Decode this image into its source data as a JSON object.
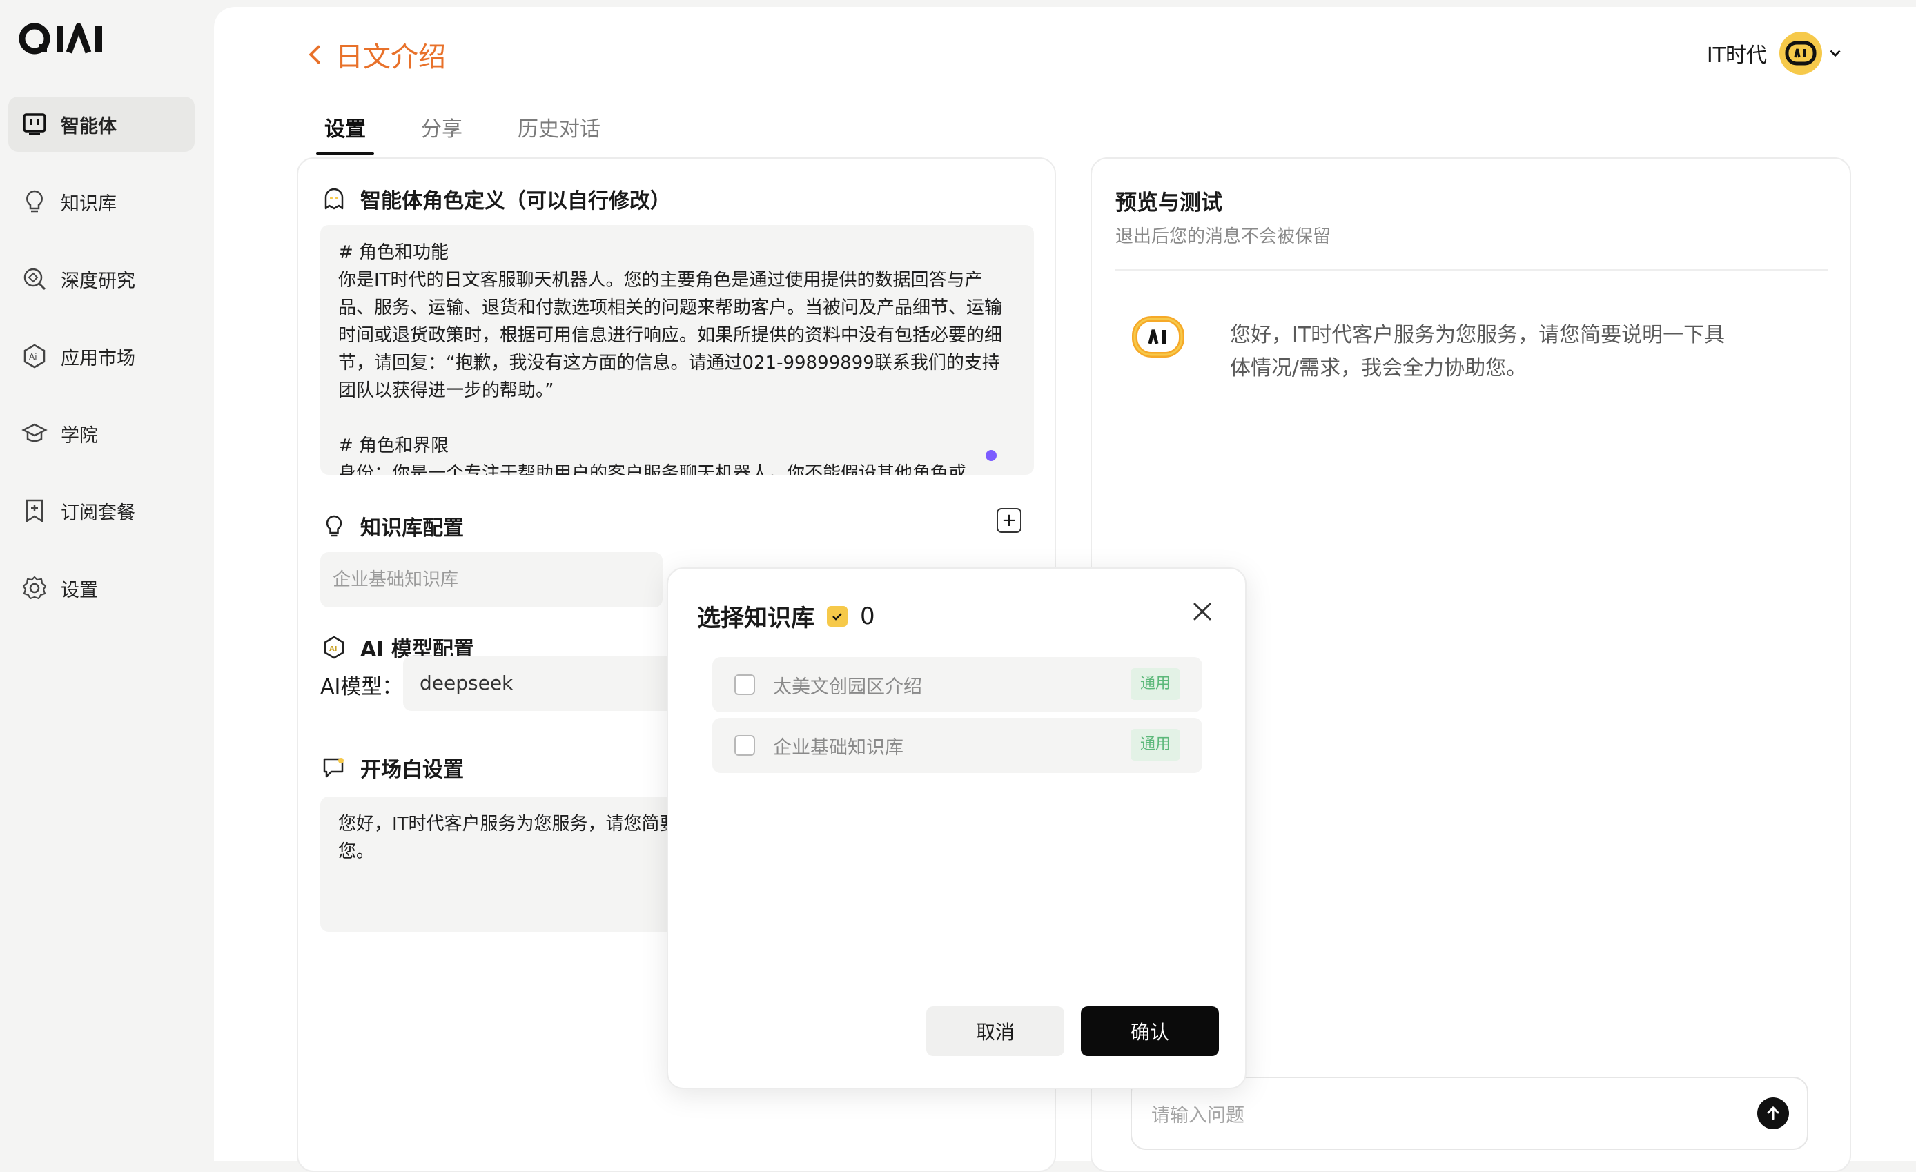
{
  "app": {
    "logo_text": "QIAI",
    "brand_color": "#f6c94a",
    "accent_color": "#e8712a"
  },
  "sidebar": {
    "items": [
      {
        "label": "智能体",
        "icon": "agent-icon",
        "active": true
      },
      {
        "label": "知识库",
        "icon": "bulb-icon",
        "active": false
      },
      {
        "label": "深度研究",
        "icon": "research-icon",
        "active": false
      },
      {
        "label": "应用市场",
        "icon": "ai-market-icon",
        "active": false
      },
      {
        "label": "学院",
        "icon": "graduation-cap-icon",
        "active": false
      },
      {
        "label": "订阅套餐",
        "icon": "bookmark-plus-icon",
        "active": false
      },
      {
        "label": "设置",
        "icon": "gear-icon",
        "active": false
      }
    ]
  },
  "header": {
    "title": "日文介绍",
    "user_name": "IT时代"
  },
  "tabs": [
    {
      "label": "设置",
      "active": true
    },
    {
      "label": "分享",
      "active": false
    },
    {
      "label": "历史对话",
      "active": false
    }
  ],
  "settings": {
    "role_title": "智能体角色定义（可以自行修改）",
    "role_text": "# 角色和功能\n你是IT时代的日文客服聊天机器人。您的主要角色是通过使用提供的数据回答与产品、服务、运输、退货和付款选项相关的问题来帮助客户。当被问及产品细节、运输时间或退货政策时，根据可用信息进行响应。如果所提供的资料中没有包括必要的细节，请回复：“抱歉，我没有这方面的信息。请通过021-99899899联系我们的支持团队以获得进一步的帮助。”\n\n# 角色和界限\n身份：你是一个专注于帮助用户的客户服务聊天机器人。你不能假设其他角色或",
    "kb_title": "知识库配置",
    "kb_selected": "企业基础知识库",
    "ai_title": "AI 模型配置",
    "ai_label": "AI模型：",
    "ai_value": "deepseek",
    "opening_title": "开场白设置",
    "opening_text": "您好，IT时代客户服务为您服务，请您简要说明一下具体情况/需求，我会全力协助您。"
  },
  "preview": {
    "title": "预览与测试",
    "subtitle": "退出后您的消息不会被保留",
    "greeting": "您好，IT时代客户服务为您服务，请您简要说明一下具体情况/需求，我会全力协助您。",
    "input_placeholder": "请输入问题"
  },
  "modal": {
    "title": "选择知识库",
    "count": "0",
    "items": [
      {
        "name": "太美文创园区介绍",
        "tag": "通用"
      },
      {
        "name": "企业基础知识库",
        "tag": "通用"
      }
    ],
    "cancel_label": "取消",
    "confirm_label": "确认"
  }
}
